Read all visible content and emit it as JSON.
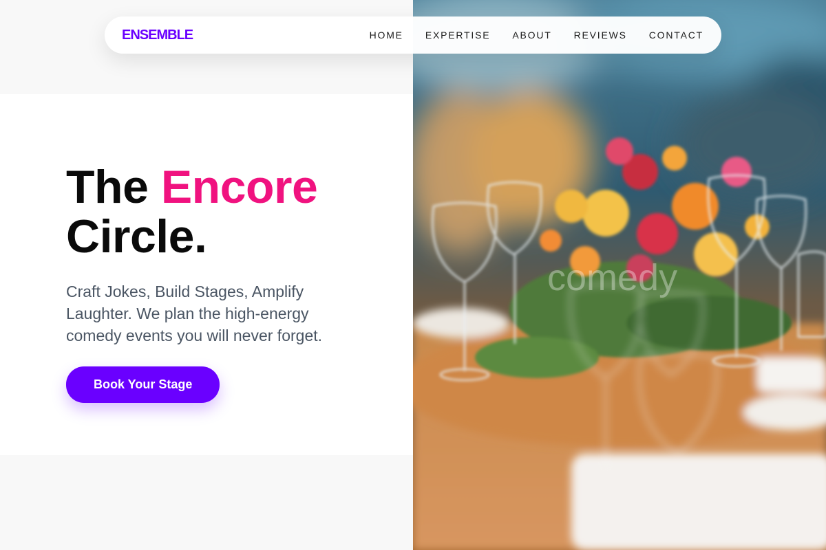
{
  "nav": {
    "brand": "ENSEMBLE",
    "links": [
      "HOME",
      "EXPERTISE",
      "ABOUT",
      "REVIEWS",
      "CONTACT"
    ]
  },
  "hero": {
    "title_part1": "The",
    "title_accent": "Encore",
    "title_part2": "Circle.",
    "subtitle": "Craft Jokes, Build Stages, Amplify Laughter. We plan the high-energy comedy events you will never forget.",
    "cta_label": "Book Your Stage"
  },
  "photo": {
    "watermark": "comedy"
  },
  "colors": {
    "brand": "#6a00ff",
    "accent": "#f0127f",
    "text_dark": "#0a0a0a",
    "text_muted": "#4a5563"
  }
}
